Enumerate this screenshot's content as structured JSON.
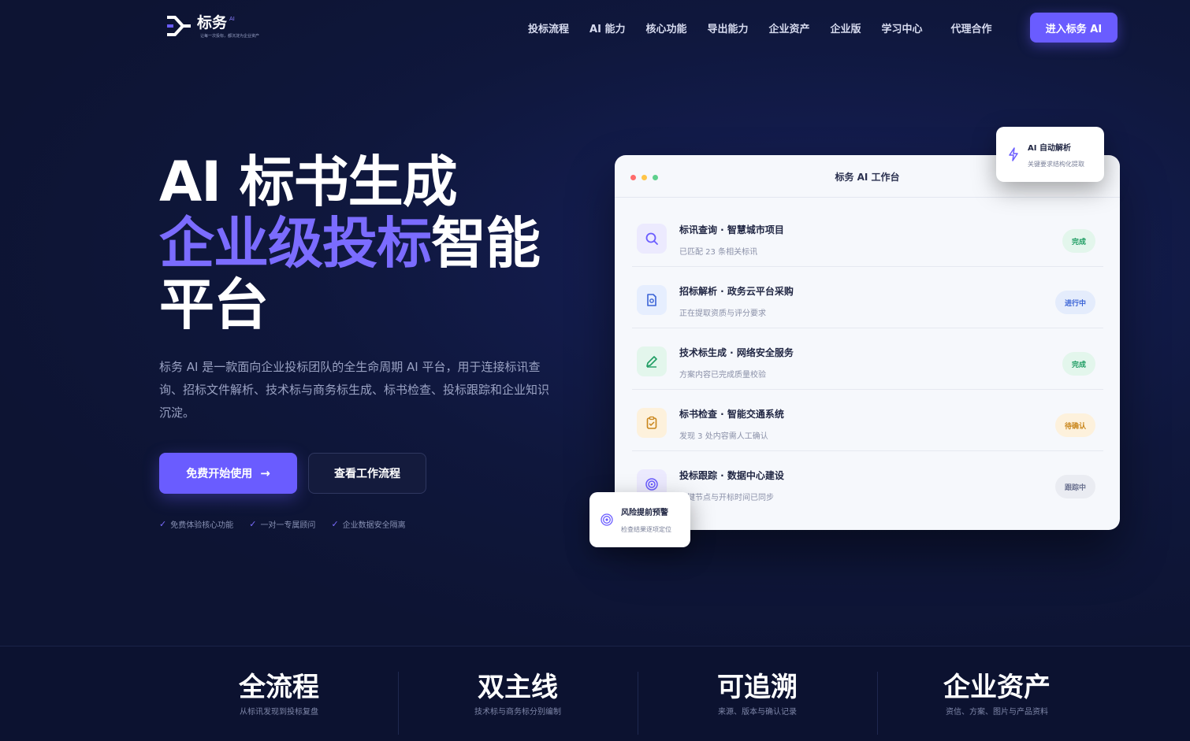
{
  "nav": {
    "logo_name": "标务",
    "logo_ai": "AI",
    "logo_slogan": "让每一次投标，都沉淀为企业资产",
    "links": [
      "投标流程",
      "AI 能力",
      "核心功能",
      "导出能力",
      "企业资产",
      "企业版",
      "学习中心",
      "代理合作"
    ],
    "cta": "进入标务 AI"
  },
  "hero": {
    "title_line1": "AI 标书生成",
    "title_line2_accent": "企业级投标",
    "title_line2_rest": "智能",
    "title_line3": "平台",
    "description": "标务 AI 是一款面向企业投标团队的全生命周期 AI 平台，用于连接标讯查询、招标文件解析、技术标与商务标生成、标书检查、投标跟踪和企业知识沉淀。",
    "primary_button": "免费开始使用",
    "secondary_button": "查看工作流程",
    "checks": [
      "免费体验核心功能",
      "一对一专属顾问",
      "企业数据安全隔离"
    ]
  },
  "panel": {
    "title": "标务 AI 工作台",
    "tasks": [
      {
        "title": "标讯查询 · 智慧城市项目",
        "sub": "已匹配 23 条相关标讯",
        "status": "完成",
        "icon": "search-icon"
      },
      {
        "title": "招标解析 · 政务云平台采购",
        "sub": "正在提取资质与评分要求",
        "status": "进行中",
        "icon": "document-icon"
      },
      {
        "title": "技术标生成 · 网络安全服务",
        "sub": "方案内容已完成质量校验",
        "status": "完成",
        "icon": "pen-icon"
      },
      {
        "title": "标书检查 · 智能交通系统",
        "sub": "发现 3 处内容需人工确认",
        "status": "待确认",
        "icon": "clipboard-icon"
      },
      {
        "title": "投标跟踪 · 数据中心建设",
        "sub": "关键节点与开标时间已同步",
        "status": "跟踪中",
        "icon": "radar-icon"
      }
    ]
  },
  "float_top": {
    "title": "AI 自动解析",
    "sub": "关键要求结构化提取",
    "icon": "lightning-icon"
  },
  "float_bottom": {
    "title": "风险提前预警",
    "sub": "检查结果逐项定位",
    "icon": "target-icon"
  },
  "stats": [
    {
      "title": "全流程",
      "sub": "从标讯发现到投标复盘"
    },
    {
      "title": "双主线",
      "sub": "技术标与商务标分别编制"
    },
    {
      "title": "可追溯",
      "sub": "来源、版本与确认记录"
    },
    {
      "title": "企业资产",
      "sub": "资信、方案、图片与产品资料"
    }
  ],
  "colors": {
    "accent": "#6a5cff",
    "background": "#0d1433",
    "status_done": "#1f9d63",
    "status_progress": "#3a63d6",
    "status_pending": "#c9851a",
    "status_tracking": "#6b7290"
  }
}
